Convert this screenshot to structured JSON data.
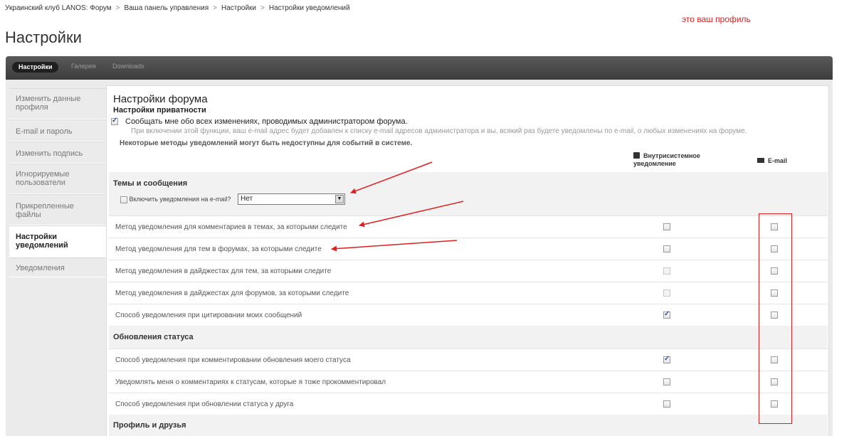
{
  "breadcrumb": [
    "Украинский клуб LANOS: Форум",
    "Ваша панель управления",
    "Настройки",
    "Настройки уведомлений"
  ],
  "breadcrumb_sep": ">",
  "profile_note": "это ваш профиль",
  "page_title": "Настройки",
  "tabs": [
    {
      "label": "Настройки",
      "active": true
    },
    {
      "label": "Галерея",
      "active": false
    },
    {
      "label": "Downloads",
      "active": false
    }
  ],
  "sidebar": {
    "items": [
      {
        "label": "Изменить данные профиля",
        "active": false
      },
      {
        "label": "E-mail и пароль",
        "active": false
      },
      {
        "label": "Изменить подпись",
        "active": false
      },
      {
        "label": "Игнорируемые пользователи",
        "active": false
      },
      {
        "label": "Прикрепленные файлы",
        "active": false
      },
      {
        "label": "Настройки уведомлений",
        "active": true
      },
      {
        "label": "Уведомления",
        "active": false
      }
    ]
  },
  "panel": {
    "forum_title": "Настройки форума",
    "privacy_title": "Настройки приватности",
    "admin_notify_label": "Сообщать мне обо всех изменениях, проводимых администратором форума.",
    "admin_notify_checked": true,
    "admin_notify_desc": "При включении этой функции, ваш e-mail адрес будет добавлен к списку e-mail адресов администратора и вы, всякий раз будете уведомлены по e-mail, о любых изменениях на форуме.",
    "methods_note": "Некоторые методы уведомлений могут быть недоступны для событий в системе.",
    "col_inapp": "Внутрисистемное уведомление",
    "col_email": "E-mail"
  },
  "sections": {
    "topics": {
      "title": "Темы и сообщения",
      "email_toggle_label": "Включить уведомления на e-mail?",
      "email_toggle_checked": false,
      "select_value": "Нет",
      "rows": [
        {
          "label": "Метод уведомления для комментариев в темах, за которыми следите",
          "inapp": "unchecked",
          "email": "unchecked"
        },
        {
          "label": "Метод уведомления для тем в форумах, за которыми следите",
          "inapp": "unchecked",
          "email": "unchecked"
        },
        {
          "label": "Метод уведомления в дайджестах для тем, за которыми следите",
          "inapp": "disabled",
          "email": "unchecked"
        },
        {
          "label": "Метод уведомления в дайджестах для форумов, за которыми следите",
          "inapp": "disabled",
          "email": "unchecked"
        },
        {
          "label": "Способ уведомления при цитировании моих сообщений",
          "inapp": "checked",
          "email": "unchecked"
        }
      ]
    },
    "status": {
      "title": "Обновления статуса",
      "rows": [
        {
          "label": "Способ уведомления при комментировании обновления моего статуса",
          "inapp": "checked",
          "email": "unchecked"
        },
        {
          "label": "Уведомлять меня о комментариях к статусам, которые я тоже прокомментировал",
          "inapp": "unchecked",
          "email": "unchecked"
        },
        {
          "label": "Способ уведомления при обновлении статуса у друга",
          "inapp": "unchecked",
          "email": "unchecked"
        }
      ]
    },
    "profile": {
      "title": "Профиль и друзья"
    }
  },
  "colors": {
    "annotation_red": "#e02020",
    "tabbar": "#4a4a4a",
    "checkmark": "#2a4fa8"
  }
}
